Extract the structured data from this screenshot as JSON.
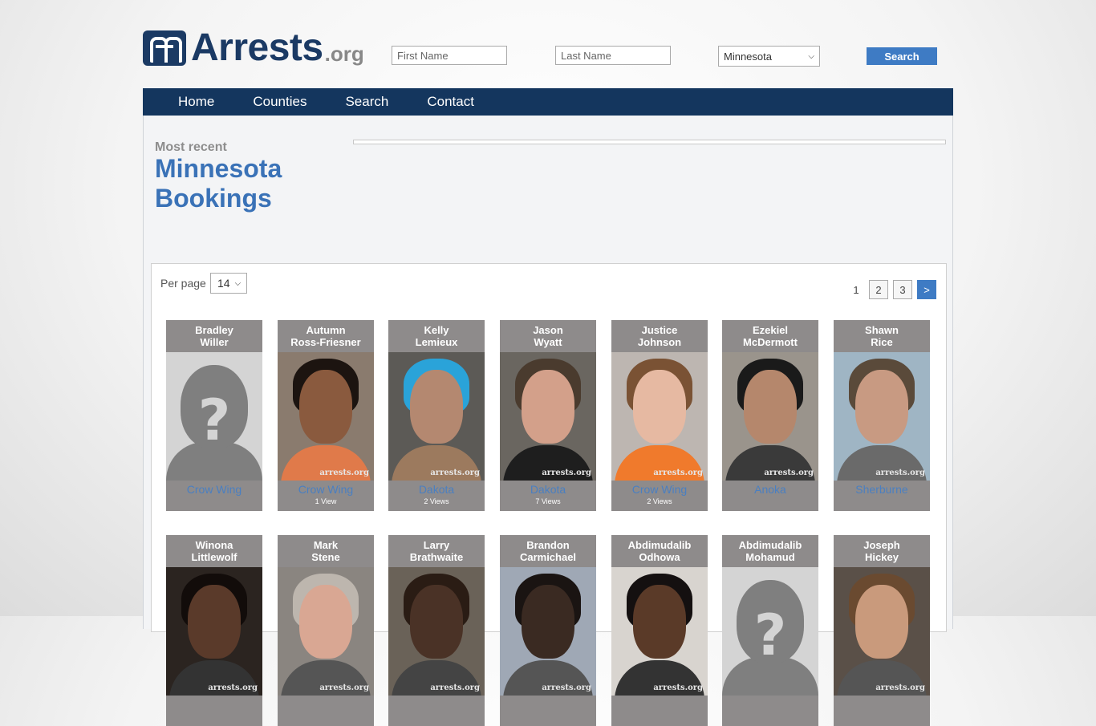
{
  "header": {
    "logo_text": "Arrests",
    "logo_suffix": ".org",
    "first_name_placeholder": "First Name",
    "last_name_placeholder": "Last Name",
    "state_selected": "Minnesota",
    "search_label": "Search"
  },
  "nav": {
    "items": [
      {
        "label": "Home"
      },
      {
        "label": "Counties"
      },
      {
        "label": "Search"
      },
      {
        "label": "Contact"
      }
    ]
  },
  "main": {
    "kicker": "Most recent",
    "title": "Minnesota Bookings",
    "per_page_label": "Per page",
    "per_page_value": "14",
    "pagination": [
      "1",
      "2",
      "3",
      ">"
    ]
  },
  "bookings": [
    {
      "first": "Bradley",
      "last": "Willer",
      "county": "Crow Wing",
      "views": "",
      "photo": "placeholder"
    },
    {
      "first": "Autumn",
      "last": "Ross-Friesner",
      "county": "Crow Wing",
      "views": "1 View",
      "photo": "mugshot"
    },
    {
      "first": "Kelly",
      "last": "Lemieux",
      "county": "Dakota",
      "views": "2 Views",
      "photo": "mugshot"
    },
    {
      "first": "Jason",
      "last": "Wyatt",
      "county": "Dakota",
      "views": "7 Views",
      "photo": "mugshot"
    },
    {
      "first": "Justice",
      "last": "Johnson",
      "county": "Crow Wing",
      "views": "2 Views",
      "photo": "mugshot"
    },
    {
      "first": "Ezekiel",
      "last": "McDermott",
      "county": "Anoka",
      "views": "",
      "photo": "mugshot"
    },
    {
      "first": "Shawn",
      "last": "Rice",
      "county": "Sherburne",
      "views": "",
      "photo": "mugshot"
    },
    {
      "first": "Winona",
      "last": "Littlewolf",
      "county": "",
      "views": "",
      "photo": "mugshot"
    },
    {
      "first": "Mark",
      "last": "Stene",
      "county": "",
      "views": "",
      "photo": "mugshot"
    },
    {
      "first": "Larry",
      "last": "Brathwaite",
      "county": "",
      "views": "",
      "photo": "mugshot"
    },
    {
      "first": "Brandon",
      "last": "Carmichael",
      "county": "",
      "views": "",
      "photo": "mugshot"
    },
    {
      "first": "Abdimudalib",
      "last": "Odhowa",
      "county": "",
      "views": "",
      "photo": "mugshot"
    },
    {
      "first": "Abdimudalib",
      "last": "Mohamud",
      "county": "",
      "views": "",
      "photo": "placeholder"
    },
    {
      "first": "Joseph",
      "last": "Hickey",
      "county": "",
      "views": "",
      "photo": "mugshot"
    }
  ],
  "watermark": "arrests.org",
  "colors": {
    "nav_bg": "#14365e",
    "accent": "#3e7bc4",
    "title": "#3a72b7",
    "card_bg": "#8e8b8b"
  }
}
